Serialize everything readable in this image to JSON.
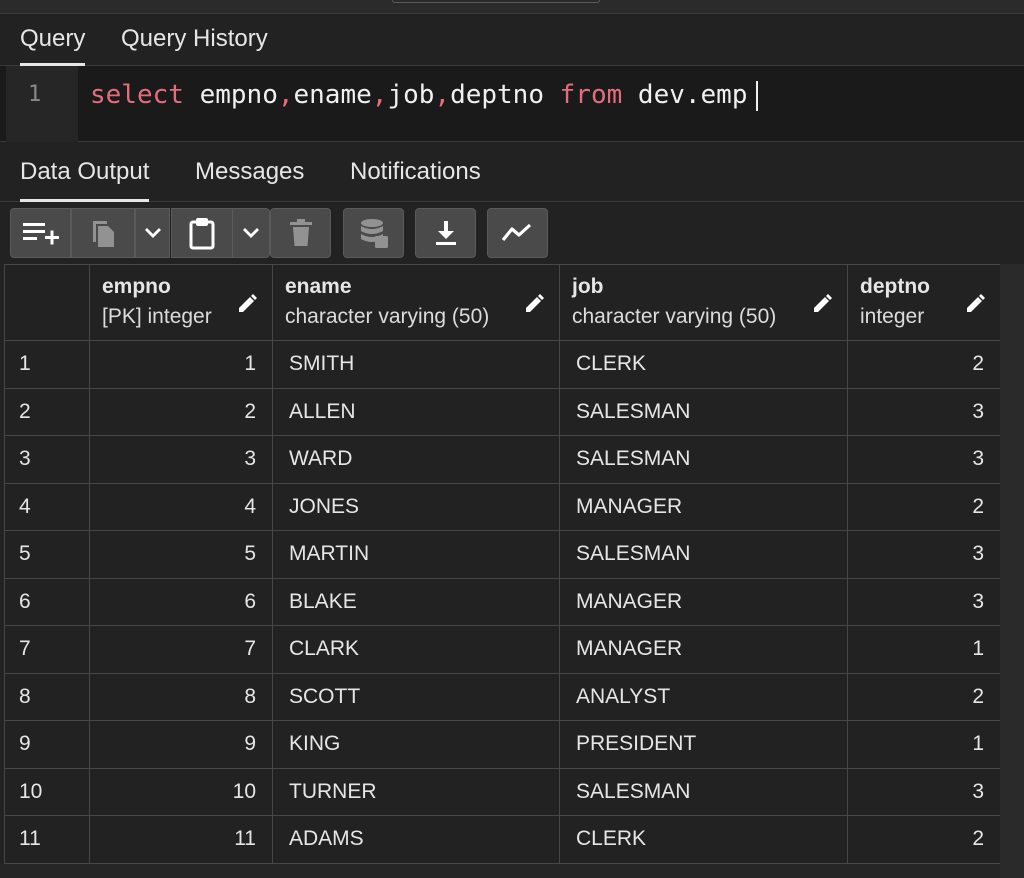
{
  "editor_tabs": [
    "Query",
    "Query History"
  ],
  "editor": {
    "line_number": "1",
    "tokens": [
      {
        "text": "select",
        "kind": "keyword"
      },
      {
        "text": " empno",
        "kind": "plain"
      },
      {
        "text": ",",
        "kind": "keyword"
      },
      {
        "text": "ename",
        "kind": "plain"
      },
      {
        "text": ",",
        "kind": "keyword"
      },
      {
        "text": "job",
        "kind": "plain"
      },
      {
        "text": ",",
        "kind": "keyword"
      },
      {
        "text": "deptno ",
        "kind": "plain"
      },
      {
        "text": "from",
        "kind": "keyword"
      },
      {
        "text": " dev.emp",
        "kind": "plain"
      }
    ],
    "keyword_color": "#e56d7b"
  },
  "result_tabs": [
    "Data Output",
    "Messages",
    "Notifications"
  ],
  "toolbar_icons": [
    "add-row-icon",
    "copy-icon",
    "chevron-down-icon",
    "paste-icon",
    "chevron-down-icon",
    "delete-icon",
    "save-data-icon",
    "download-icon",
    "graph-icon"
  ],
  "grid": {
    "columns": [
      {
        "name": "empno",
        "type": "[PK] integer"
      },
      {
        "name": "ename",
        "type": "character varying (50)"
      },
      {
        "name": "job",
        "type": "character varying (50)"
      },
      {
        "name": "deptno",
        "type": "integer"
      }
    ],
    "rows": [
      [
        "1",
        "1",
        "SMITH",
        "CLERK",
        "2"
      ],
      [
        "2",
        "2",
        "ALLEN",
        "SALESMAN",
        "3"
      ],
      [
        "3",
        "3",
        "WARD",
        "SALESMAN",
        "3"
      ],
      [
        "4",
        "4",
        "JONES",
        "MANAGER",
        "2"
      ],
      [
        "5",
        "5",
        "MARTIN",
        "SALESMAN",
        "3"
      ],
      [
        "6",
        "6",
        "BLAKE",
        "MANAGER",
        "3"
      ],
      [
        "7",
        "7",
        "CLARK",
        "MANAGER",
        "1"
      ],
      [
        "8",
        "8",
        "SCOTT",
        "ANALYST",
        "2"
      ],
      [
        "9",
        "9",
        "KING",
        "PRESIDENT",
        "1"
      ],
      [
        "10",
        "10",
        "TURNER",
        "SALESMAN",
        "3"
      ],
      [
        "11",
        "11",
        "ADAMS",
        "CLERK",
        "2"
      ]
    ]
  }
}
